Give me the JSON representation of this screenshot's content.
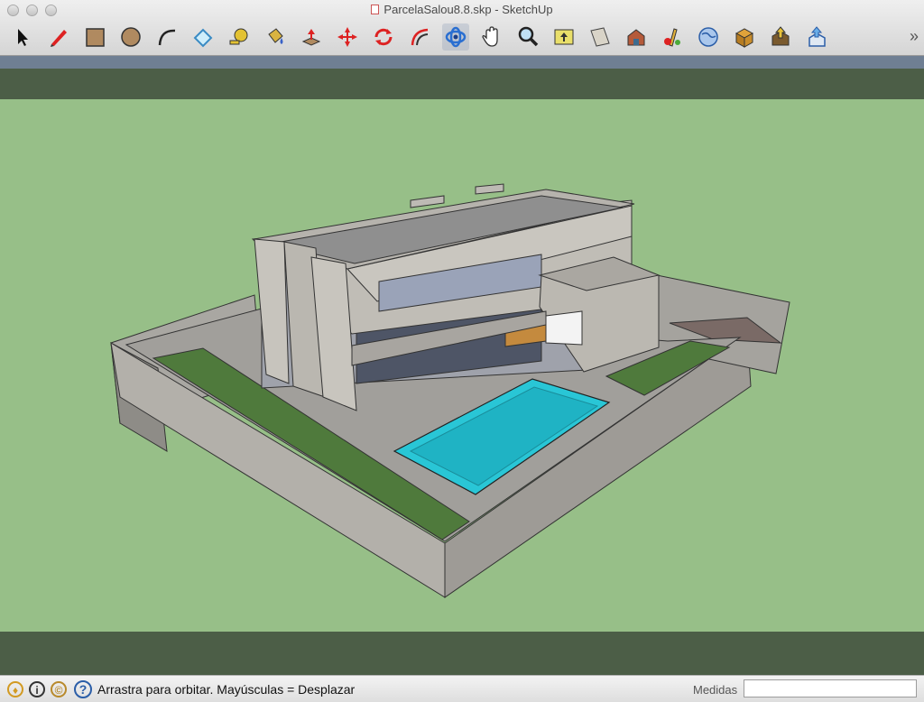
{
  "window": {
    "title": "ParcelaSalou8.8.skp - SketchUp"
  },
  "toolbar": {
    "tools": [
      {
        "icon": "select-arrow-icon"
      },
      {
        "icon": "pencil-line-icon"
      },
      {
        "icon": "rectangle-icon"
      },
      {
        "icon": "circle-icon"
      },
      {
        "icon": "arc-icon"
      },
      {
        "icon": "eraser-icon"
      },
      {
        "icon": "tape-measure-icon"
      },
      {
        "icon": "paint-bucket-icon"
      },
      {
        "icon": "push-pull-icon"
      },
      {
        "icon": "move-icon"
      },
      {
        "icon": "rotate-icon"
      },
      {
        "icon": "offset-icon"
      },
      {
        "icon": "orbit-icon",
        "active": true
      },
      {
        "icon": "pan-hand-icon"
      },
      {
        "icon": "zoom-magnifier-icon"
      },
      {
        "icon": "zoom-extents-icon"
      },
      {
        "icon": "section-plane-icon"
      },
      {
        "icon": "warehouse-icon"
      },
      {
        "icon": "components-icon"
      },
      {
        "icon": "earth-icon"
      },
      {
        "icon": "extension-warehouse-icon"
      },
      {
        "icon": "get-model-icon"
      },
      {
        "icon": "share-model-icon"
      },
      {
        "icon": "layout-icon"
      }
    ],
    "overflow_icon": "chevron-double-right-icon",
    "overflow_glyph": "»"
  },
  "status": {
    "icons": [
      "geo-location-icon",
      "credits-icon",
      "signin-icon",
      "help-icon"
    ],
    "help_glyph": "?",
    "message": "Arrastra para orbitar. Mayúsculas = Desplazar",
    "measure_label": "Medidas",
    "measure_value": ""
  },
  "colors": {
    "ground": "#97bf88",
    "sky": "#4c5e47",
    "pool": "#29c6d6",
    "grass": "#4f7a3c",
    "stone": "#b9b6b0"
  }
}
